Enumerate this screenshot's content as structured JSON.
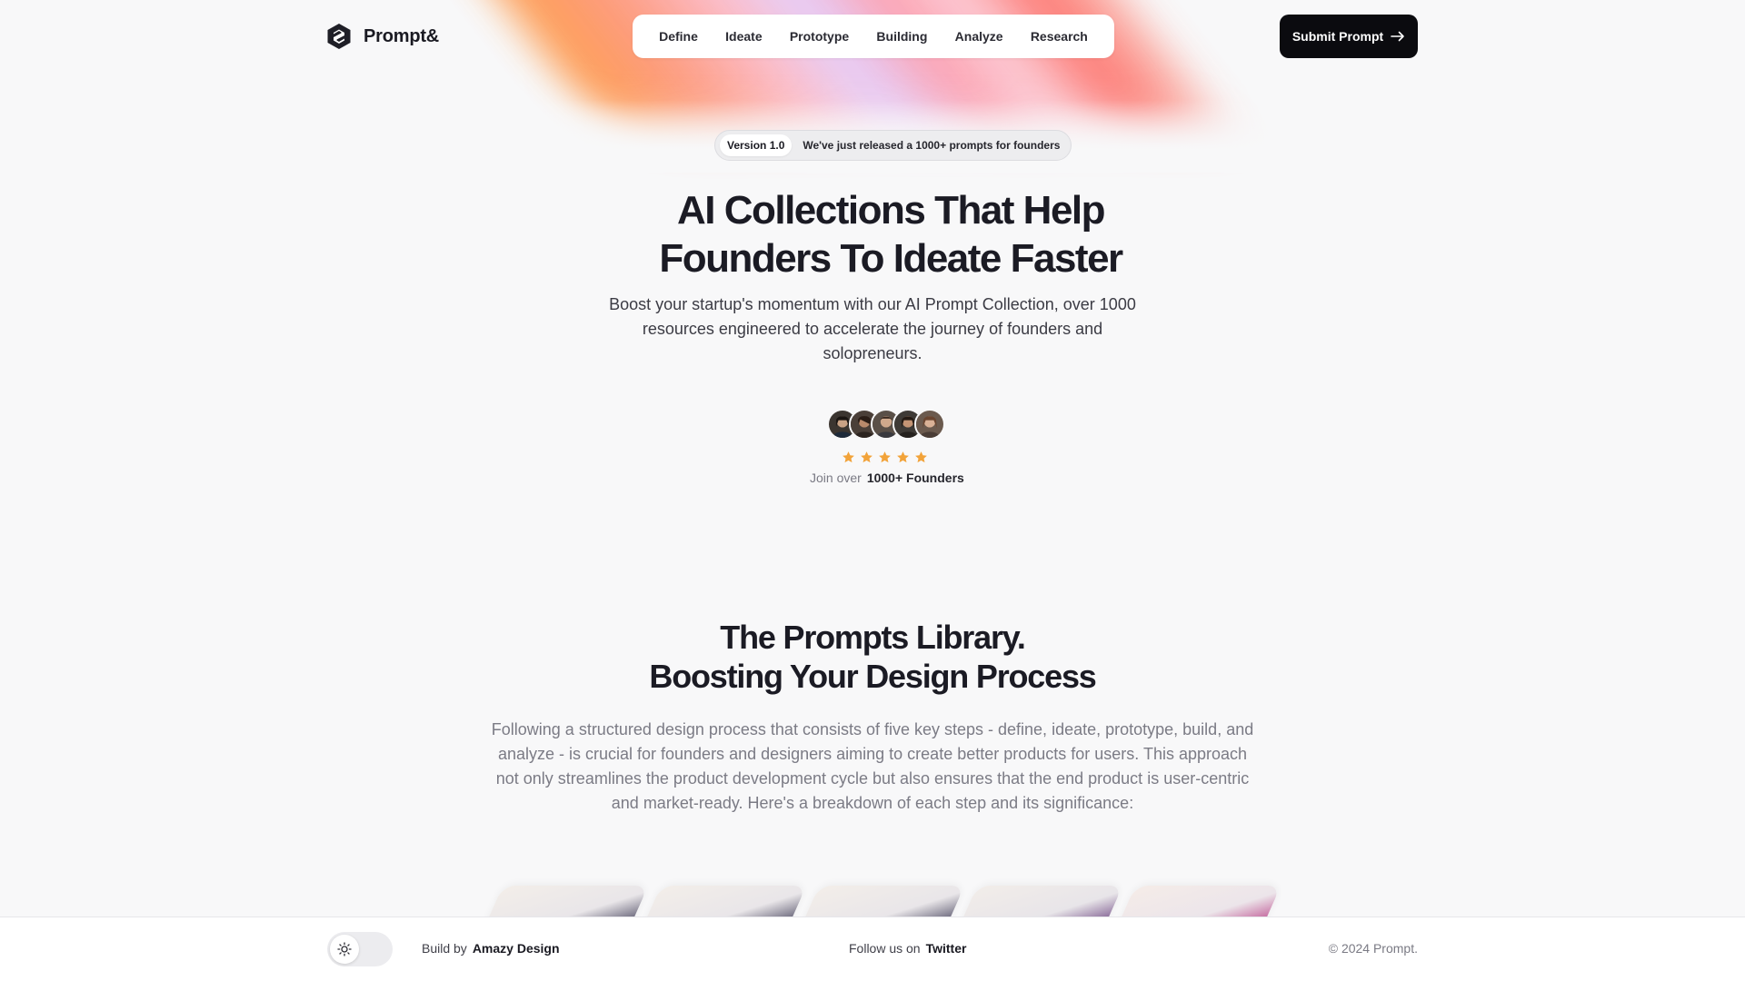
{
  "brand": {
    "name": "Prompt&",
    "logo_icon": "hexagon-s-logo-icon"
  },
  "nav": {
    "items": [
      {
        "label": "Define"
      },
      {
        "label": "Ideate"
      },
      {
        "label": "Prototype"
      },
      {
        "label": "Building"
      },
      {
        "label": "Analyze"
      },
      {
        "label": "Research"
      }
    ]
  },
  "header": {
    "cta_label": "Submit Prompt",
    "cta_icon": "arrow-right-icon"
  },
  "hero": {
    "badge_version": "Version 1.0",
    "badge_text": "We've just released a 1000+ prompts for founders",
    "title_line1": "AI Collections That Help",
    "title_line2": "Founders To Ideate Faster",
    "subtitle": "Boost your startup's momentum with our AI Prompt Collection, over 1000 resources engineered to accelerate the journey of founders and solopreneurs.",
    "rating": 5,
    "join_prefix": "Join over",
    "join_count": "1000+ Founders"
  },
  "library": {
    "title_line1": "The Prompts Library.",
    "title_line2": "Boosting Your Design Process",
    "description": "Following a structured design process that consists of five key steps - define, ideate, prototype, build, and analyze - is crucial for founders and designers aiming to create better products for users. This approach not only streamlines the product development cycle but also ensures that the end product is user-centric and market-ready. Here's a breakdown of each step and its significance:"
  },
  "footer": {
    "theme_icon": "sun-icon",
    "build_prefix": "Build by",
    "build_link": "Amazy Design",
    "follow_prefix": "Follow us on",
    "follow_link": "Twitter",
    "copyright": "© 2024 Prompt."
  },
  "colors": {
    "background": "#f8f8f9",
    "text_primary": "#1b1b24",
    "cta_background": "#0b0b0f",
    "star": "#f2a33a"
  }
}
